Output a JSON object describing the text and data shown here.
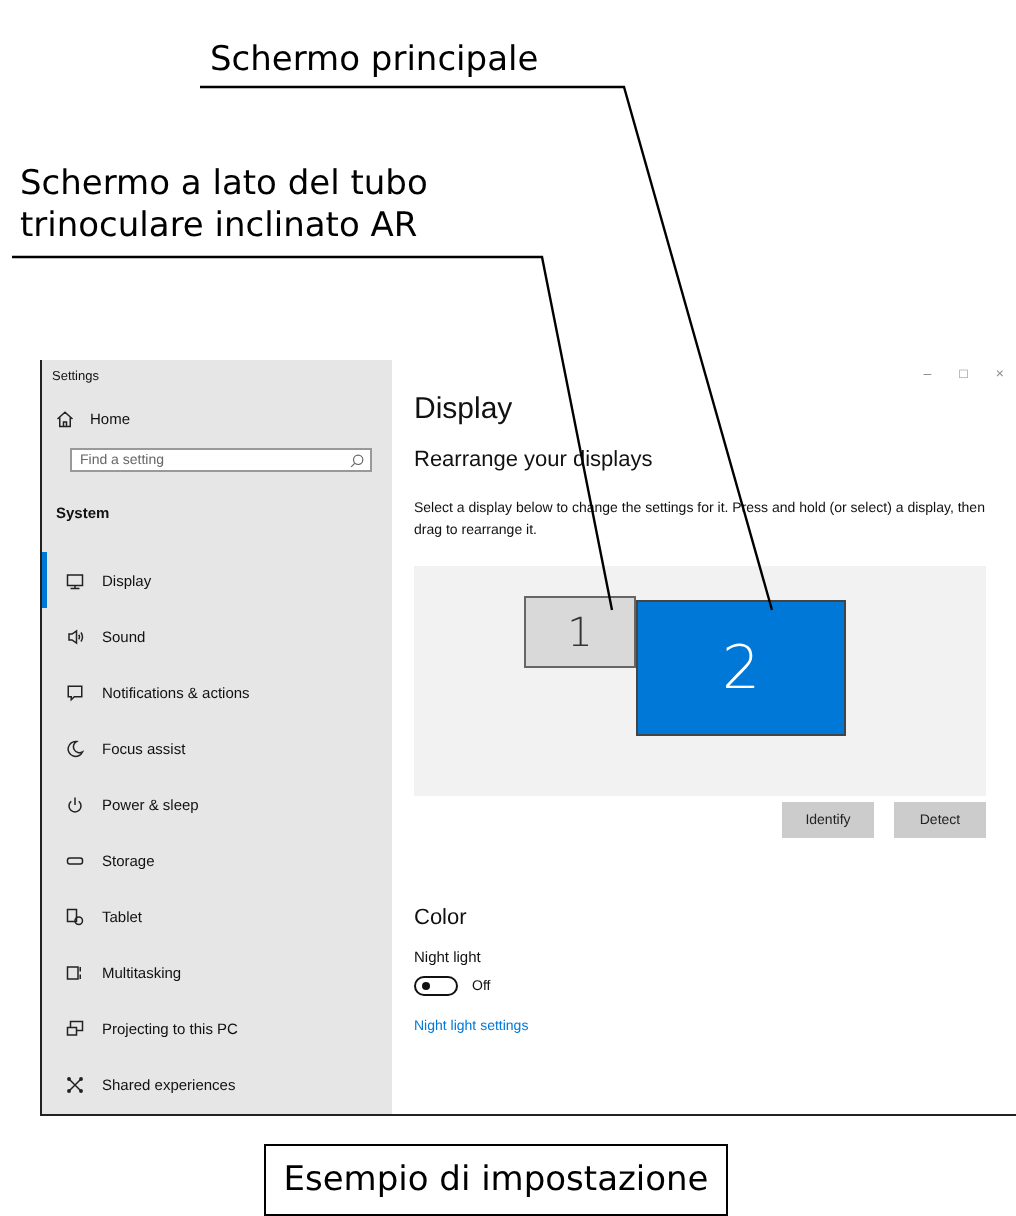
{
  "annotations": [
    {
      "text": "Schermo principale"
    },
    {
      "text": "Schermo a lato del tubo trinoculare inclinato AR"
    }
  ],
  "window": {
    "title": "Settings",
    "controls": [
      "–",
      "□",
      "×"
    ]
  },
  "sidebar": {
    "home": "Home",
    "search": {
      "placeholder": "Find a setting"
    },
    "section": "System",
    "items": [
      {
        "label": "Display",
        "selected": true
      },
      {
        "label": "Sound",
        "selected": false
      },
      {
        "label": "Notifications & actions",
        "selected": false
      },
      {
        "label": "Focus assist",
        "selected": false
      },
      {
        "label": "Power & sleep",
        "selected": false
      },
      {
        "label": "Storage",
        "selected": false
      },
      {
        "label": "Tablet",
        "selected": false
      },
      {
        "label": "Multitasking",
        "selected": false
      },
      {
        "label": "Projecting to this PC",
        "selected": false
      },
      {
        "label": "Shared experiences",
        "selected": false
      }
    ]
  },
  "main": {
    "heading": "Display",
    "subheading": "Rearrange your displays",
    "description": "Select a display below to change the settings for it. Press and hold (or select) a display, then drag to rearrange it.",
    "displays": [
      {
        "label": "1",
        "selected": false
      },
      {
        "label": "2",
        "selected": true
      }
    ],
    "buttons": [
      "Identify",
      "Detect"
    ],
    "color_heading": "Color",
    "night_light": {
      "label": "Night light",
      "on": false,
      "state_text": "Off"
    },
    "link": "Night light settings"
  },
  "caption": "Esempio di impostazione"
}
